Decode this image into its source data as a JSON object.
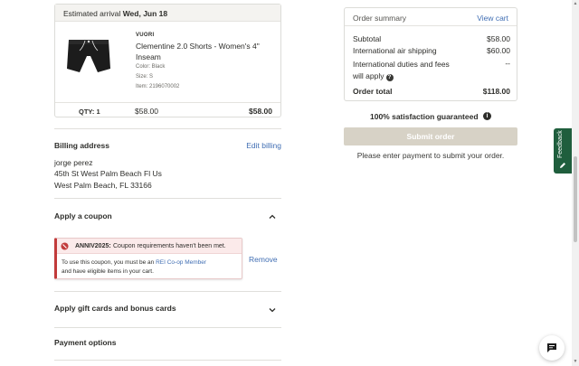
{
  "shipment": {
    "arrival_label": "Estimated arrival",
    "arrival_date": "Wed, Jun 18"
  },
  "item": {
    "brand": "VUORI",
    "name": "Clementine 2.0 Shorts - Women's 4\" Inseam",
    "color": "Color: Black",
    "size": "Size: S",
    "item_no": "Item: 2196070002",
    "qty": "QTY: 1",
    "unit_price": "$58.00",
    "line_total": "$58.00"
  },
  "billing": {
    "title": "Billing address",
    "edit_label": "Edit billing",
    "name": "jorge perez",
    "line1": "45th St West Palm Beach Fl Us",
    "line2": "West Palm Beach, FL 33166"
  },
  "coupon": {
    "title": "Apply a coupon",
    "code": "ANNIV2025:",
    "error": "Coupon requirements haven't been met.",
    "detail_pre": "To use this coupon, you must be an",
    "detail_link": "REI Co-op Member",
    "detail_post": "and have eligible items in your cart.",
    "remove_label": "Remove"
  },
  "gift": {
    "title": "Apply gift cards and bonus cards"
  },
  "payment": {
    "title": "Payment options"
  },
  "summary": {
    "title": "Order summary",
    "view_cart": "View cart",
    "subtotal_label": "Subtotal",
    "subtotal": "$58.00",
    "shipping_label": "International air shipping",
    "shipping": "$60.00",
    "duties_label_1": "International duties and fees",
    "duties_label_2": "will apply",
    "duties": "--",
    "total_label": "Order total",
    "total": "$118.00"
  },
  "guarantee": "100% satisfaction guaranteed",
  "submit_label": "Submit order",
  "submit_note": "Please enter payment to submit your order.",
  "feedback_label": "Feedback",
  "colors": {
    "link": "#406eb3",
    "error": "#c23b3b",
    "submit_disabled": "#d7d2c6",
    "feedback_tab": "#1f5e3d"
  }
}
